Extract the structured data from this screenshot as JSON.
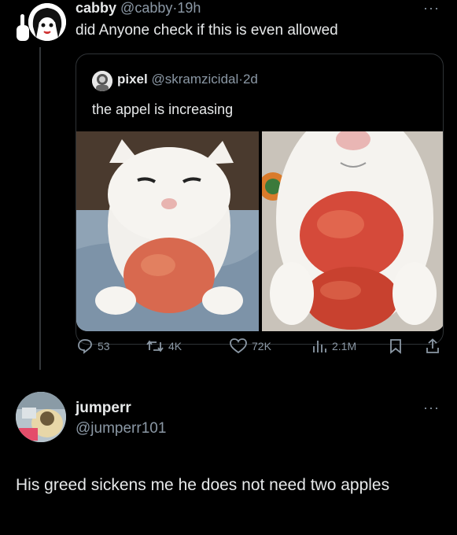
{
  "post": {
    "author_name": "cabby",
    "author_handle": "@cabby",
    "separator": "·",
    "time": "19h",
    "text": "did Anyone check if this is even allowed",
    "more": "···"
  },
  "quoted_post": {
    "author_name": "pixel",
    "author_handle": "@skramzicidal",
    "separator": "·",
    "time": "2d",
    "text": "the appel is increasing"
  },
  "actions": {
    "replies": "53",
    "reposts": "4K",
    "likes": "72K",
    "views": "2.1M"
  },
  "reply": {
    "author_name": "jumperr",
    "author_handle": "@jumperr101",
    "more": "···",
    "text": "His greed sickens me he does not need two apples"
  },
  "colors": {
    "background": "#000000",
    "text": "#e7e9ea",
    "muted": "#8b98a5",
    "border": "#2f3336"
  }
}
